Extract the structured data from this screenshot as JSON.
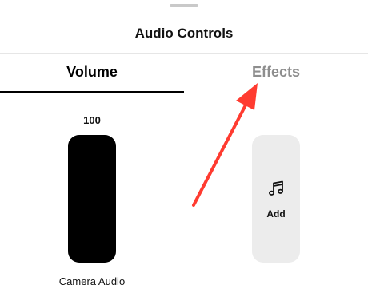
{
  "sheet": {
    "title": "Audio Controls"
  },
  "tabs": [
    {
      "label": "Volume",
      "selected": true
    },
    {
      "label": "Effects",
      "selected": false
    }
  ],
  "volume": {
    "value": "100",
    "level": 1.0,
    "source_label": "Camera Audio"
  },
  "effects": {
    "add_label": "Add",
    "add_icon": "music-note-icon"
  },
  "annotation": {
    "type": "arrow",
    "color": "#ff3b30",
    "points_to": "tab-effects"
  },
  "colors": {
    "accent": "#000000",
    "annotation": "#ff3b30"
  }
}
